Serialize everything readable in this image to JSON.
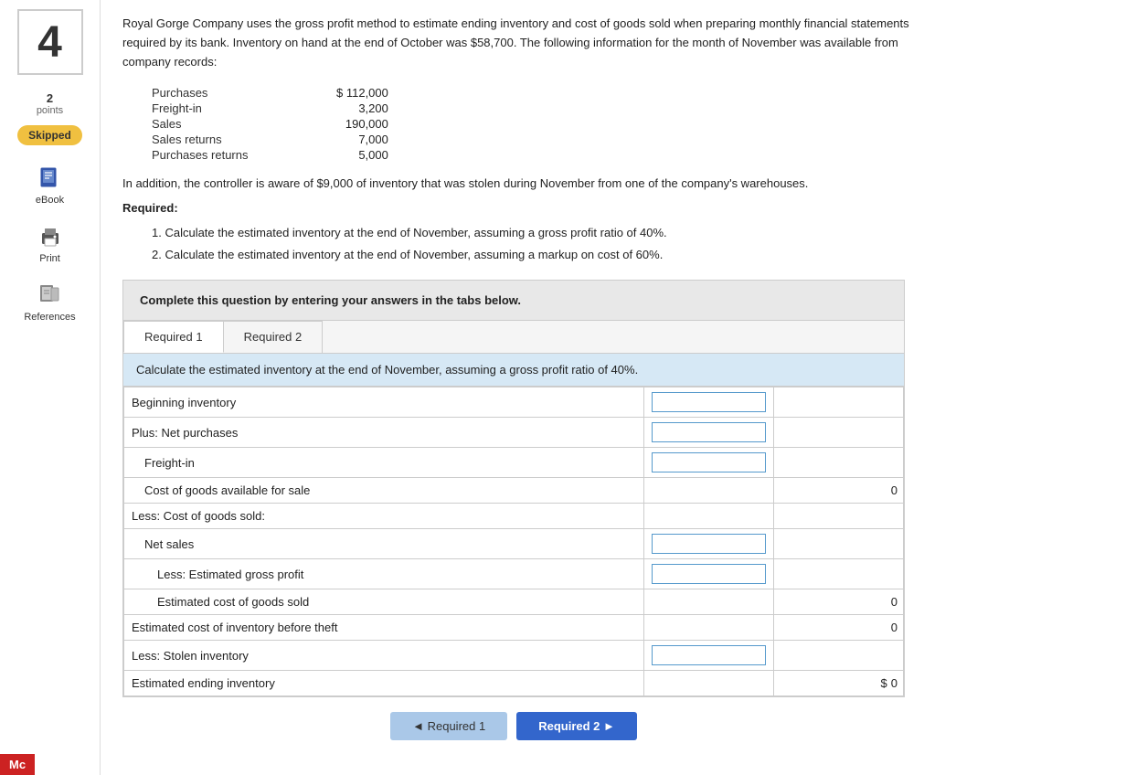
{
  "question": {
    "number": "4",
    "points": "2",
    "points_label": "points",
    "status": "Skipped"
  },
  "sidebar": {
    "ebook_label": "eBook",
    "print_label": "Print",
    "references_label": "References"
  },
  "question_text": "Royal Gorge Company uses the gross profit method to estimate ending inventory and cost of goods sold when preparing monthly financial statements required by its bank. Inventory on hand at the end of October was $58,700. The following information for the month of November was available from company records:",
  "data_items": [
    {
      "label": "Purchases",
      "value": "$ 112,000"
    },
    {
      "label": "Freight-in",
      "value": "3,200"
    },
    {
      "label": "Sales",
      "value": "190,000"
    },
    {
      "label": "Sales returns",
      "value": "7,000"
    },
    {
      "label": "Purchases returns",
      "value": "5,000"
    }
  ],
  "additional_text": "In addition, the controller is aware of $9,000 of inventory that was stolen during November from one of the company's warehouses.",
  "required_label": "Required:",
  "required_items": [
    "1. Calculate the estimated inventory at the end of November, assuming a gross profit ratio of 40%.",
    "2. Calculate the estimated inventory at the end of November, assuming a markup on cost of 60%."
  ],
  "complete_box_text": "Complete this question by entering your answers in the tabs below.",
  "tabs": [
    {
      "label": "Required 1",
      "active": true
    },
    {
      "label": "Required 2",
      "active": false
    }
  ],
  "tab1_description": "Calculate the estimated inventory at the end of November, assuming a gross profit ratio of 40%.",
  "table_rows": [
    {
      "label": "Beginning inventory",
      "col2": "",
      "col3": "",
      "indent": 0,
      "input2": true,
      "input3": false,
      "value3": ""
    },
    {
      "label": "Plus: Net purchases",
      "col2": "",
      "col3": "",
      "indent": 0,
      "input2": true,
      "input3": false,
      "value3": ""
    },
    {
      "label": "Freight-in",
      "col2": "",
      "col3": "",
      "indent": 1,
      "input2": true,
      "input3": false,
      "value3": ""
    },
    {
      "label": "Cost of goods available for sale",
      "col2": "",
      "col3": "0",
      "indent": 1,
      "input2": false,
      "input3": false,
      "value3": "0"
    },
    {
      "label": "Less: Cost of goods sold:",
      "col2": "",
      "col3": "",
      "indent": 0,
      "input2": false,
      "input3": false,
      "value3": ""
    },
    {
      "label": "Net sales",
      "col2": "",
      "col3": "",
      "indent": 1,
      "input2": true,
      "input3": false,
      "value3": ""
    },
    {
      "label": "Less: Estimated gross profit",
      "col2": "",
      "col3": "",
      "indent": 2,
      "input2": true,
      "input3": false,
      "value3": ""
    },
    {
      "label": "Estimated cost of goods sold",
      "col2": "",
      "col3": "0",
      "indent": 2,
      "input2": false,
      "input3": false,
      "value3": "0"
    },
    {
      "label": "Estimated cost of inventory before theft",
      "col2": "",
      "col3": "0",
      "indent": 0,
      "input2": false,
      "input3": false,
      "value3": "0"
    },
    {
      "label": "Less: Stolen inventory",
      "col2": "",
      "col3": "",
      "indent": 0,
      "input2": true,
      "input3": false,
      "value3": ""
    },
    {
      "label": "Estimated ending inventory",
      "col2": "$",
      "col3": "0",
      "indent": 0,
      "input2": false,
      "input3": false,
      "value3": "0",
      "dollar": true
    }
  ],
  "buttons": {
    "prev_label": "◄  Required 1",
    "next_label": "Required 2  ►"
  },
  "bottom_label": "Mc"
}
